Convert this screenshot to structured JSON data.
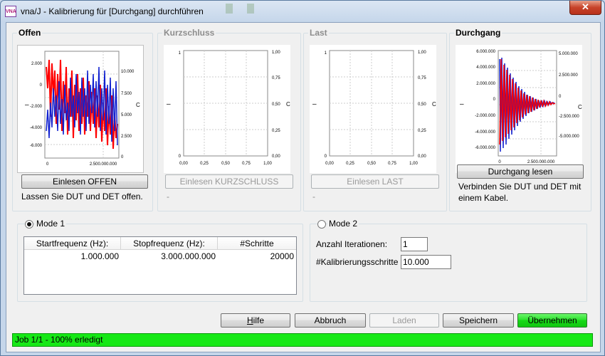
{
  "window": {
    "title": "vna/J - Kalibrierung für [Durchgang] durchführen",
    "app_icon_text": "VNA",
    "close_glyph": "✕"
  },
  "panels": [
    {
      "id": "offen",
      "title": "Offen",
      "active": true,
      "button_label": "Einlesen OFFEN",
      "description": "Lassen Sie DUT und DET offen.",
      "y_left_label": "–",
      "y_right_label": "C",
      "left_ticks": [
        "2.000",
        "0",
        "-2.000",
        "-4.000",
        "-6.000"
      ],
      "right_ticks": [
        "10.000",
        "7.500",
        "5.000",
        "2.500",
        "0"
      ],
      "x_ticks": [
        "0",
        "2.500.000.000"
      ]
    },
    {
      "id": "kurzschluss",
      "title": "Kurzschluss",
      "active": false,
      "button_label": "Einlesen KURZSCHLUSS",
      "description": "-",
      "y_left_label": "–",
      "y_right_label": "C",
      "left_ticks": [
        "1",
        "0"
      ],
      "right_ticks": [
        "1,00",
        "0,75",
        "0,50",
        "0,25",
        "0,00"
      ],
      "x_ticks": [
        "0,00",
        "0,25",
        "0,50",
        "0,75",
        "1,00"
      ]
    },
    {
      "id": "last",
      "title": "Last",
      "active": false,
      "button_label": "Einlesen LAST",
      "description": "-",
      "y_left_label": "–",
      "y_right_label": "C",
      "left_ticks": [
        "1",
        "0"
      ],
      "right_ticks": [
        "1,00",
        "0,75",
        "0,50",
        "0,25",
        "0,00"
      ],
      "x_ticks": [
        "0,00",
        "0,25",
        "0,50",
        "0,75",
        "1,00"
      ]
    },
    {
      "id": "durchgang",
      "title": "Durchgang",
      "active": true,
      "button_label": "Durchgang lesen",
      "description_line1": "Verbinden Sie DUT und DET mit",
      "description_line2": "einem Kabel.",
      "y_left_label": "–",
      "y_right_label": "C",
      "left_ticks": [
        "6.000.000",
        "4.000.000",
        "2.000.000",
        "0",
        "-2.000.000",
        "-4.000.000",
        "-6.000.000"
      ],
      "right_ticks": [
        "5.000.000",
        "2.500.000",
        "0",
        "-2.500.000",
        "-5.000.000"
      ],
      "x_ticks": [
        "0",
        "2.500.000.000"
      ]
    }
  ],
  "mode1": {
    "label": "Mode 1",
    "selected": true,
    "columns": [
      "Startfrequenz (Hz):",
      "Stopfrequenz (Hz):",
      "#Schritte"
    ],
    "row": [
      "1.000.000",
      "3.000.000.000",
      "20000"
    ]
  },
  "mode2": {
    "label": "Mode 2",
    "selected": false,
    "iterations_label": "Anzahl Iterationen:",
    "iterations_value": "1",
    "steps_label": "#Kalibrierungsschritte",
    "steps_value": "10.000"
  },
  "buttons": {
    "hilfe": "Hilfe",
    "abbruch": "Abbruch",
    "laden": "Laden",
    "speichern": "Speichern",
    "uebernehmen": "Übernehmen"
  },
  "status": "Job 1/1 - 100% erledigt",
  "colors": {
    "series_red": "#ff0000",
    "series_blue": "#1020d0",
    "status_green": "#16e816"
  }
}
